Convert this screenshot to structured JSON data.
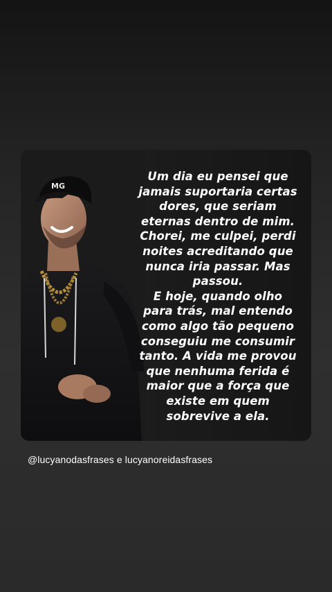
{
  "story": {
    "quote_lines": [
      "Um dia eu pensei que",
      "jamais suportaria certas",
      "dores, que seriam",
      "eternas dentro de mim.",
      "Chorei, me culpei, perdi",
      "noites acreditando que",
      "nunca iria passar. Mas",
      "passou.",
      "E hoje, quando olho",
      "para trás, mal entendo",
      "como algo tão pequeno",
      "conseguiu me consumir",
      "tanto. A vida me provou",
      "que nenhuma ferida é",
      "maior que a força que",
      "existe em quem",
      "sobrevive a ela."
    ],
    "cap_logo": "MG"
  },
  "mention": "@lucyanodasfrases e lucyanoreidasfrases"
}
